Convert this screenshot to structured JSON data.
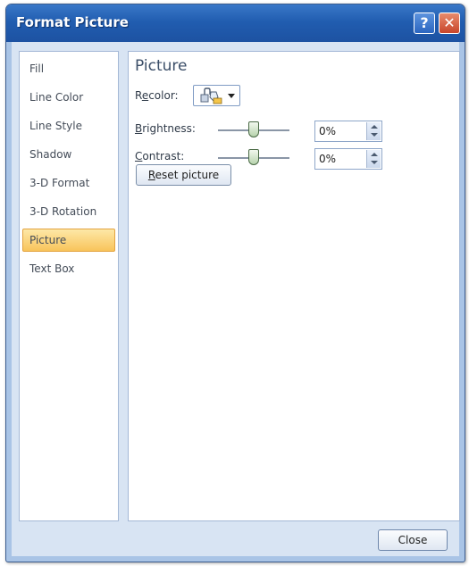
{
  "window": {
    "title": "Format Picture",
    "help_label": "?",
    "close_label": "✕"
  },
  "nav": {
    "items": [
      {
        "label": "Fill"
      },
      {
        "label": "Line Color"
      },
      {
        "label": "Line Style"
      },
      {
        "label": "Shadow"
      },
      {
        "label": "3-D Format"
      },
      {
        "label": "3-D Rotation"
      },
      {
        "label": "Picture"
      },
      {
        "label": "Text Box"
      }
    ],
    "selected": "Picture"
  },
  "panel": {
    "heading": "Picture",
    "recolor": {
      "label_pre": "R",
      "label_key": "e",
      "label_post": "color:",
      "icon": "recolor-icon"
    },
    "brightness": {
      "label_key": "B",
      "label_post": "rightness:",
      "value": "0%",
      "slider_level_pct": 50
    },
    "contrast": {
      "label_key": "C",
      "label_post": "ontrast:",
      "value": "0%",
      "slider_level_pct": 50
    },
    "reset": {
      "label_key": "R",
      "label_post": "eset picture"
    }
  },
  "footer": {
    "close_label": "Close"
  },
  "colors": {
    "title_bar": "#215db0",
    "selected_item": "#f8c45b",
    "client_bg": "#d8e4f3"
  }
}
